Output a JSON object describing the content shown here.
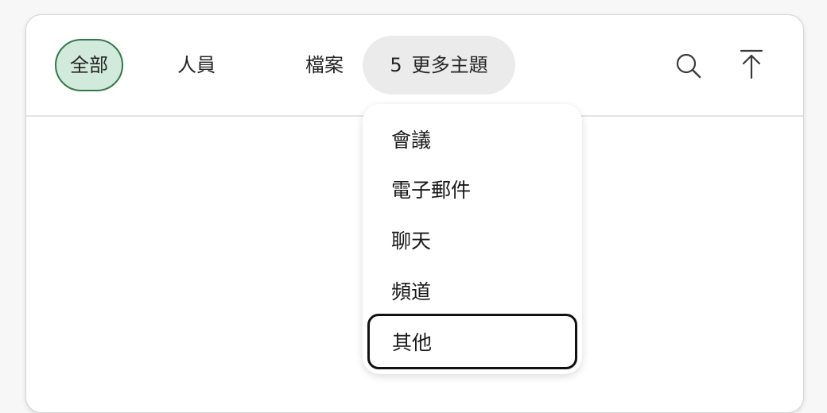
{
  "tabs": {
    "all": "全部",
    "people": "人員",
    "files": "檔案",
    "more_count": "5",
    "more_label": "更多主題"
  },
  "icons": {
    "search": "search-icon",
    "scroll_top": "arrow-up-to-top-icon"
  },
  "dropdown": {
    "items": [
      {
        "label": "會議"
      },
      {
        "label": "電子郵件"
      },
      {
        "label": "聊天"
      },
      {
        "label": "頻道"
      },
      {
        "label": "其他",
        "focused": true
      }
    ]
  },
  "colors": {
    "selected_tab_bg": "#d2eadb",
    "selected_tab_border": "#2f7a4a",
    "more_tab_bg": "#ebebeb",
    "focus_ring": "#111111"
  }
}
